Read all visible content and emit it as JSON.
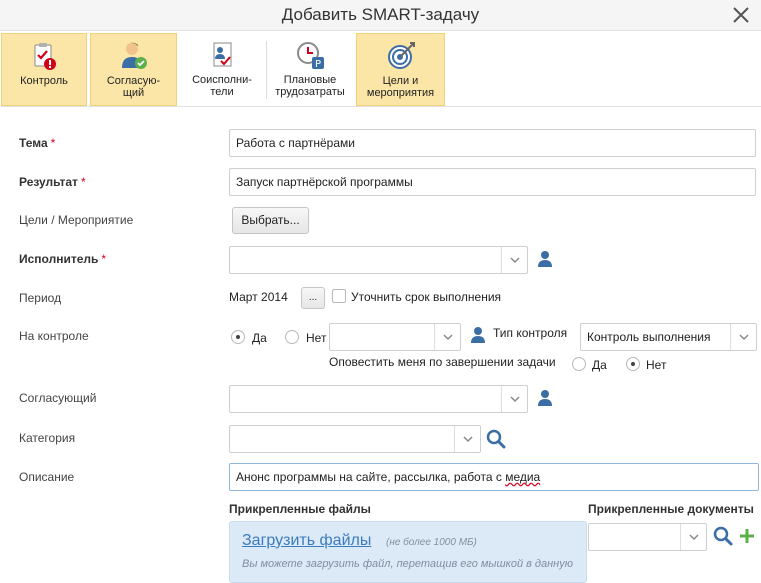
{
  "window": {
    "title": "Добавить SMART-задачу"
  },
  "toolbar": {
    "items": [
      {
        "label": "Контроль",
        "icon": "clipboard-alert-icon",
        "active": true
      },
      {
        "label": "Согласую-\nщий",
        "icon": "user-approve-icon",
        "active": true
      },
      {
        "label": "Соисполни-\nтели",
        "icon": "doc-users-icon",
        "active": false
      },
      {
        "label": "Плановые\nтрудозатраты",
        "icon": "clock-plan-icon",
        "active": false
      },
      {
        "label": "Цели и\nмероприятия",
        "icon": "target-icon",
        "active": true
      }
    ]
  },
  "form": {
    "topic": {
      "label": "Тема",
      "value": "Работа с партнёрами"
    },
    "result": {
      "label": "Результат",
      "value": "Запуск партнёрской программы"
    },
    "goals": {
      "label": "Цели / Мероприятие",
      "button": "Выбрать..."
    },
    "executor": {
      "label": "Исполнитель",
      "value": ""
    },
    "period": {
      "label": "Период",
      "value": "Март 2014",
      "button": "...",
      "checkbox_label": "Уточнить срок выполнения"
    },
    "control": {
      "label": "На контроле",
      "yes": "Да",
      "no": "Нет",
      "controller_value": "",
      "type_label": "Тип контроля",
      "type_value": "Контроль выполнения",
      "notify_label": "Оповестить меня по завершении задачи",
      "notify_yes": "Да",
      "notify_no": "Нет"
    },
    "approver": {
      "label": "Согласующий",
      "value": ""
    },
    "category": {
      "label": "Категория",
      "value": ""
    },
    "description": {
      "label": "Описание",
      "value_main": "Анонс программы на сайте, рассылка, работа с ",
      "value_spell": "медиа"
    }
  },
  "attachments": {
    "files_title": "Прикрепленные файлы",
    "docs_title": "Прикрепленные документы",
    "upload_link": "Загрузить файлы",
    "upload_limit": "(не более 1000 МБ)",
    "upload_hint": "Вы можете загрузить файл, перетащив его мышкой в данную"
  },
  "colors": {
    "active_tab": "#fbe6a8",
    "required": "#d0021b",
    "link": "#3b7bbf",
    "icon_blue": "#3b6ea5",
    "upload_bg": "#dce9f6"
  }
}
